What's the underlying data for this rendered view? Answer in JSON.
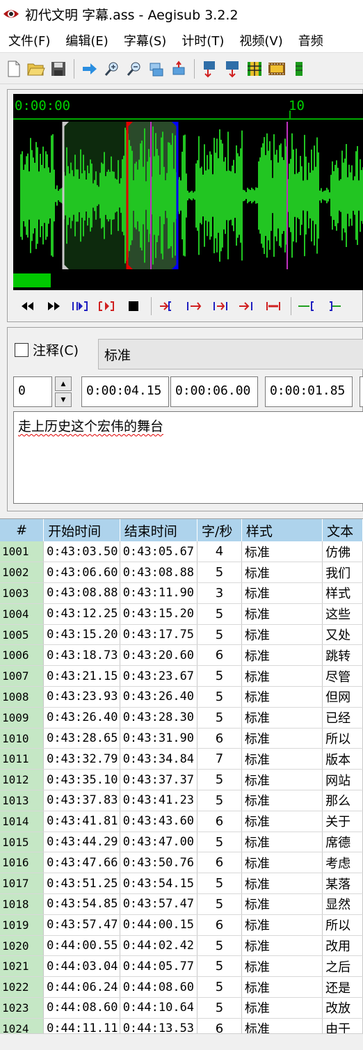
{
  "window": {
    "title": "初代文明 字幕.ass - Aegisub 3.2.2"
  },
  "menu": [
    "文件(F)",
    "编辑(E)",
    "字幕(S)",
    "计时(T)",
    "视频(V)",
    "音频"
  ],
  "toolbar_icons": [
    "new-file-icon",
    "open-folder-icon",
    "save-icon",
    "jump-arrow-icon",
    "zoom-in-icon",
    "zoom-out-icon",
    "snap-icon",
    "move-icon",
    "style-manager-icon",
    "translation-icon",
    "subtitle-grid-icon",
    "video-frame-icon",
    "extra-icon"
  ],
  "audio": {
    "time_start": "0:00:00",
    "time_mark": "10",
    "colors": {
      "wave": "#22c522",
      "selection": "#1f5a1f",
      "start_marker": "#e00000",
      "end_marker": "#0000ff",
      "keyframe": "#c030c0"
    }
  },
  "editor": {
    "comment_label": "注释(C)",
    "style": "标准",
    "layer": "0",
    "start_time": "0:00:04.15",
    "end_time": "0:00:06.00",
    "duration": "0:00:01.85",
    "text": "走上历史这个宏伟的舞台"
  },
  "grid": {
    "headers": [
      "#",
      "开始时间",
      "结束时间",
      "字/秒",
      "样式",
      "文本"
    ],
    "rows": [
      [
        "1001",
        "0:43:03.50",
        "0:43:05.67",
        "4",
        "标准",
        "仿佛"
      ],
      [
        "1002",
        "0:43:06.60",
        "0:43:08.88",
        "5",
        "标准",
        "我们"
      ],
      [
        "1003",
        "0:43:08.88",
        "0:43:11.90",
        "3",
        "标准",
        "样式"
      ],
      [
        "1004",
        "0:43:12.25",
        "0:43:15.20",
        "5",
        "标准",
        "这些"
      ],
      [
        "1005",
        "0:43:15.20",
        "0:43:17.75",
        "5",
        "标准",
        "又处"
      ],
      [
        "1006",
        "0:43:18.73",
        "0:43:20.60",
        "6",
        "标准",
        "跳转"
      ],
      [
        "1007",
        "0:43:21.15",
        "0:43:23.67",
        "5",
        "标准",
        "尽管"
      ],
      [
        "1008",
        "0:43:23.93",
        "0:43:26.40",
        "5",
        "标准",
        "但网"
      ],
      [
        "1009",
        "0:43:26.40",
        "0:43:28.30",
        "5",
        "标准",
        "已经"
      ],
      [
        "1010",
        "0:43:28.65",
        "0:43:31.90",
        "6",
        "标准",
        "所以"
      ],
      [
        "1011",
        "0:43:32.79",
        "0:43:34.84",
        "7",
        "标准",
        "版本"
      ],
      [
        "1012",
        "0:43:35.10",
        "0:43:37.37",
        "5",
        "标准",
        "网站"
      ],
      [
        "1013",
        "0:43:37.83",
        "0:43:41.23",
        "5",
        "标准",
        "那么"
      ],
      [
        "1014",
        "0:43:41.81",
        "0:43:43.60",
        "6",
        "标准",
        "关于"
      ],
      [
        "1015",
        "0:43:44.29",
        "0:43:47.00",
        "5",
        "标准",
        "席德"
      ],
      [
        "1016",
        "0:43:47.66",
        "0:43:50.76",
        "6",
        "标准",
        "考虑"
      ],
      [
        "1017",
        "0:43:51.25",
        "0:43:54.15",
        "5",
        "标准",
        "某落"
      ],
      [
        "1018",
        "0:43:54.85",
        "0:43:57.47",
        "5",
        "标准",
        "显然"
      ],
      [
        "1019",
        "0:43:57.47",
        "0:44:00.15",
        "6",
        "标准",
        "所以"
      ],
      [
        "1020",
        "0:44:00.55",
        "0:44:02.42",
        "5",
        "标准",
        "改用"
      ],
      [
        "1021",
        "0:44:03.04",
        "0:44:05.77",
        "5",
        "标准",
        "之后"
      ],
      [
        "1022",
        "0:44:06.24",
        "0:44:08.60",
        "5",
        "标准",
        "还是"
      ],
      [
        "1023",
        "0:44:08.60",
        "0:44:10.64",
        "5",
        "标准",
        "改放"
      ],
      [
        "1024",
        "0:44:11.11",
        "0:44:13.53",
        "6",
        "标准",
        "由于"
      ]
    ]
  }
}
